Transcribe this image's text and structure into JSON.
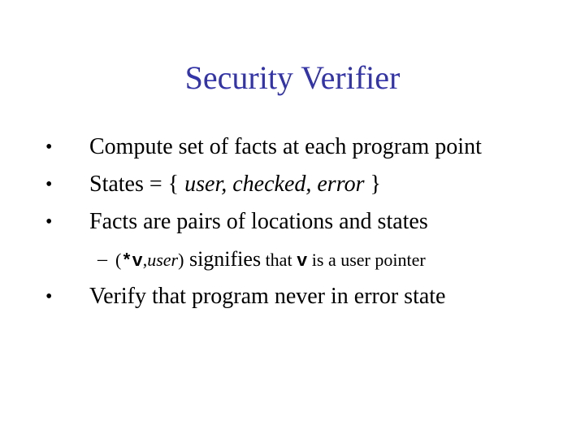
{
  "slide": {
    "title": "Security Verifier",
    "title_color": "#3333aa",
    "bullet_glyph": "•",
    "dash_glyph": "–",
    "bullets": [
      {
        "text": "Compute set of facts at each program point"
      },
      {
        "prefix": "States = { ",
        "italic": "user, checked, error",
        "suffix": " }"
      },
      {
        "text": "Facts are pairs of locations and states"
      },
      {
        "text": "Verify that program never in error state"
      }
    ],
    "sub_bullet": {
      "open": "(",
      "code1": "*v",
      "comma": ",",
      "italic": "user",
      "close": ")",
      "word": " signifies",
      "middle": " that ",
      "code2": "v",
      "rest": " is a user pointer"
    }
  }
}
